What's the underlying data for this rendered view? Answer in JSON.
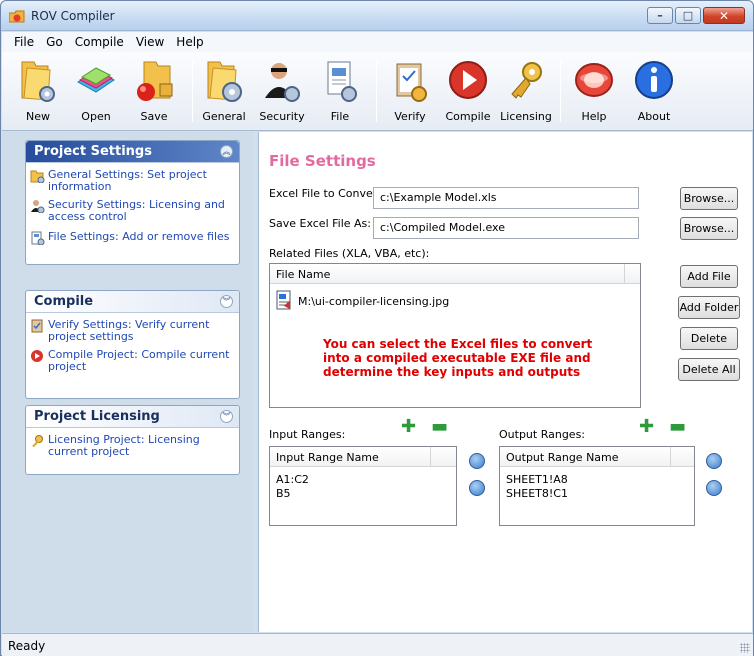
{
  "window": {
    "title": "ROV Compiler"
  },
  "menu": [
    "File",
    "Go",
    "Compile",
    "View",
    "Help"
  ],
  "toolbar": [
    {
      "label": "New",
      "icon": "folder-gear-icon"
    },
    {
      "label": "Open",
      "icon": "open-book-icon"
    },
    {
      "label": "Save",
      "icon": "folder-lock-icon"
    },
    {
      "label": "General",
      "icon": "folder-gear-icon"
    },
    {
      "label": "Security",
      "icon": "security-agent-icon"
    },
    {
      "label": "File",
      "icon": "file-settings-icon"
    },
    {
      "label": "Verify",
      "icon": "clipboard-check-icon"
    },
    {
      "label": "Compile",
      "icon": "play-icon"
    },
    {
      "label": "Licensing",
      "icon": "key-icon"
    },
    {
      "label": "Help",
      "icon": "help-lifebuoy-icon"
    },
    {
      "label": "About",
      "icon": "info-icon"
    }
  ],
  "sidebar": {
    "project_settings": {
      "title": "Project Settings",
      "items": [
        "General Settings: Set project information",
        "Security Settings: Licensing and access control",
        "File Settings: Add or remove files"
      ]
    },
    "compile": {
      "title": "Compile",
      "items": [
        "Verify Settings: Verify current project settings",
        "Compile Project: Compile current project"
      ]
    },
    "licensing": {
      "title": "Project Licensing",
      "items": [
        "Licensing Project: Licensing current project"
      ]
    }
  },
  "main": {
    "title": "File Settings",
    "excel_label": "Excel File to Convert:",
    "excel_value": "c:\\Example Model.xls",
    "save_label": "Save Excel File As:",
    "save_value": "c:\\Compiled Model.exe",
    "browse": "Browse...",
    "related_label": "Related Files (XLA, VBA, etc):",
    "files_header": "File Name",
    "files": [
      "M:\\ui-compiler-licensing.jpg"
    ],
    "add_file": "Add File",
    "add_folder": "Add Folder",
    "delete": "Delete",
    "delete_all": "Delete All",
    "note": "You can select the Excel files to convert into a compiled executable EXE file and determine the key inputs and outputs",
    "input_ranges_label": "Input Ranges:",
    "input_header": "Input Range Name",
    "inputs": [
      "A1:C2",
      "B5"
    ],
    "output_ranges_label": "Output Ranges:",
    "output_header": "Output Range Name",
    "outputs": [
      "SHEET1!A8",
      "SHEET8!C1"
    ]
  },
  "status": {
    "text": "Ready"
  }
}
